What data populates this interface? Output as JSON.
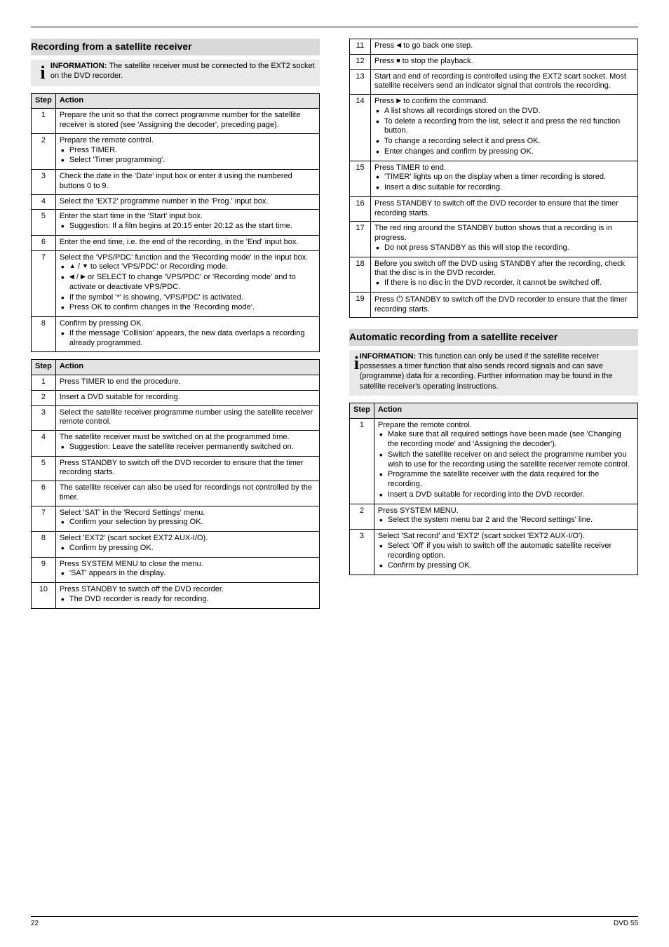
{
  "icons": {
    "info": "i",
    "power": "⏻"
  },
  "headers": {
    "step": "Step",
    "action": "Action"
  },
  "left": {
    "section_title": "Recording from a satellite receiver",
    "note": {
      "label": "INFORMATION:",
      "text": "The satellite receiver must be connected to the EXT2 socket on the DVD recorder."
    },
    "tA": [
      {
        "s": "1",
        "t": "Prepare the unit so that the correct programme number for the satellite receiver is stored (see 'Assigning the decoder', preceding page)."
      },
      {
        "s": "2",
        "t": "Prepare the remote control.",
        "b": [
          "Press TIMER.",
          "Select 'Timer programming'."
        ]
      },
      {
        "s": "3",
        "t": "Check the date in the 'Date' input box or enter it using the numbered buttons 0 to 9."
      },
      {
        "s": "4",
        "t": "Select the 'EXT2' programme number in the 'Prog.' input box."
      },
      {
        "s": "5",
        "t": "Enter the start time in the 'Start' input box.",
        "b": [
          "Suggestion: If a film begins at 20:15 enter 20:12 as the start time."
        ]
      },
      {
        "s": "6",
        "t": "Enter the end time, i.e. the end of the recording, in the 'End' input box."
      },
      {
        "s": "7",
        "t": "Select the 'VPS/PDC' function and the 'Recording mode' in the input box.",
        "b": [
          " to select 'VPS/PDC' or Recording mode.",
          " or SELECT to change 'VPS/PDC' or 'Recording mode' and to activate or deactivate VPS/PDC.",
          "If the symbol '*' is showing, 'VPS/PDC' is activated.",
          "Press OK to confirm changes in the 'Recording mode'."
        ]
      },
      {
        "s": "8",
        "t": "Confirm by pressing OK.",
        "b": [
          "If the message 'Collision' appears, the new data overlaps a recording already programmed."
        ]
      }
    ],
    "tB": [
      {
        "s": "1",
        "t": "Press TIMER to end the procedure."
      },
      {
        "s": "2",
        "t": "Insert a DVD suitable for recording."
      },
      {
        "s": "3",
        "t": "Select the satellite receiver programme number using the satellite receiver remote control."
      },
      {
        "s": "4",
        "t": "The satellite receiver must be switched on at the programmed time.",
        "b": [
          "Suggestion: Leave the satellite receiver permanently switched on."
        ]
      },
      {
        "s": "5",
        "t": "Press STANDBY to switch off the DVD recorder to ensure that the timer recording starts."
      },
      {
        "s": "6",
        "t": "The satellite receiver can also be used for recordings not controlled by the timer."
      },
      {
        "s": "7",
        "t": "Select 'SAT' in the 'Record Settings' menu.",
        "b": [
          "Confirm your selection by pressing OK."
        ]
      },
      {
        "s": "8",
        "t": "Select 'EXT2' (scart socket EXT2 AUX-I/O).",
        "b": [
          "Confirm by pressing OK."
        ]
      },
      {
        "s": "9",
        "t": "Press SYSTEM MENU to close the menu.",
        "b": [
          "'SAT' appears in the display."
        ]
      },
      {
        "s": "10",
        "t": "Press STANDBY to switch off the DVD recorder.",
        "b": [
          "The DVD recorder is ready for recording."
        ]
      }
    ]
  },
  "right": {
    "tC": [
      {
        "s": "11",
        "pre": "Press ",
        "post": " to go back one step."
      },
      {
        "s": "12",
        "pre": "Press ",
        "post": " to stop the playback."
      },
      {
        "s": "13",
        "t": "Start and end of recording is controlled using the EXT2 scart socket. Most satellite receivers send an indicator signal that controls the recording."
      },
      {
        "s": "14",
        "pre": "Press ",
        "post": " to confirm the command.",
        "b": [
          "A list shows all recordings stored on the DVD.",
          "To delete a recording from the list, select it and press the red function button.",
          "To change a recording select it and press OK.",
          "Enter changes and confirm by pressing OK."
        ]
      },
      {
        "s": "15",
        "t": "Press TIMER to end.",
        "b": [
          "'TIMER' lights up on the display when a timer recording is stored.",
          "Insert a disc suitable for recording."
        ]
      },
      {
        "s": "16",
        "t": "Press STANDBY to switch off the DVD recorder to ensure that the timer recording starts."
      },
      {
        "s": "17",
        "t": "The red ring around the STANDBY button shows that a recording is in progress.",
        "b": [
          "Do not press STANDBY as this will stop the recording."
        ]
      },
      {
        "s": "18",
        "t": "Before you switch off the DVD using STANDBY after the recording, check that the disc is in the DVD recorder.",
        "b": [
          "If there is no disc in the DVD recorder, it cannot be switched off."
        ]
      },
      {
        "s": "19",
        "pre": "Press ",
        "post": " STANDBY to switch off the DVD recorder to ensure that the timer recording starts."
      }
    ],
    "section_title": "Automatic recording from a satellite receiver",
    "note": {
      "label": "INFORMATION:",
      "text": "This function can only be used if the satellite receiver possesses a timer function that also sends record signals and can save (programme) data for a recording. Further information may be found in the satellite receiver's operating instructions."
    },
    "tD": [
      {
        "s": "1",
        "t": "Prepare the remote control.",
        "b": [
          "Make sure that all required settings have been made (see 'Changing the recording mode' and 'Assigning the decoder').",
          "Switch the satellite receiver on and select the programme number you wish to use for the recording using the satellite receiver remote control.",
          "Programme the satellite receiver with the data required for the recording.",
          "Insert a DVD suitable for recording into the DVD recorder."
        ]
      },
      {
        "s": "2",
        "t": "Press SYSTEM MENU.",
        "b": [
          "Select the system menu bar 2 and the 'Record settings' line."
        ]
      },
      {
        "s": "3",
        "t": "Select 'Sat record' and 'EXT2' (scart socket 'EXT2 AUX-I/O').",
        "b": [
          "Select 'Off' if you wish to switch off the automatic satellite receiver recording option.",
          "Confirm by pressing OK."
        ]
      }
    ]
  },
  "footer": {
    "left": "22",
    "right": "DVD 55"
  }
}
